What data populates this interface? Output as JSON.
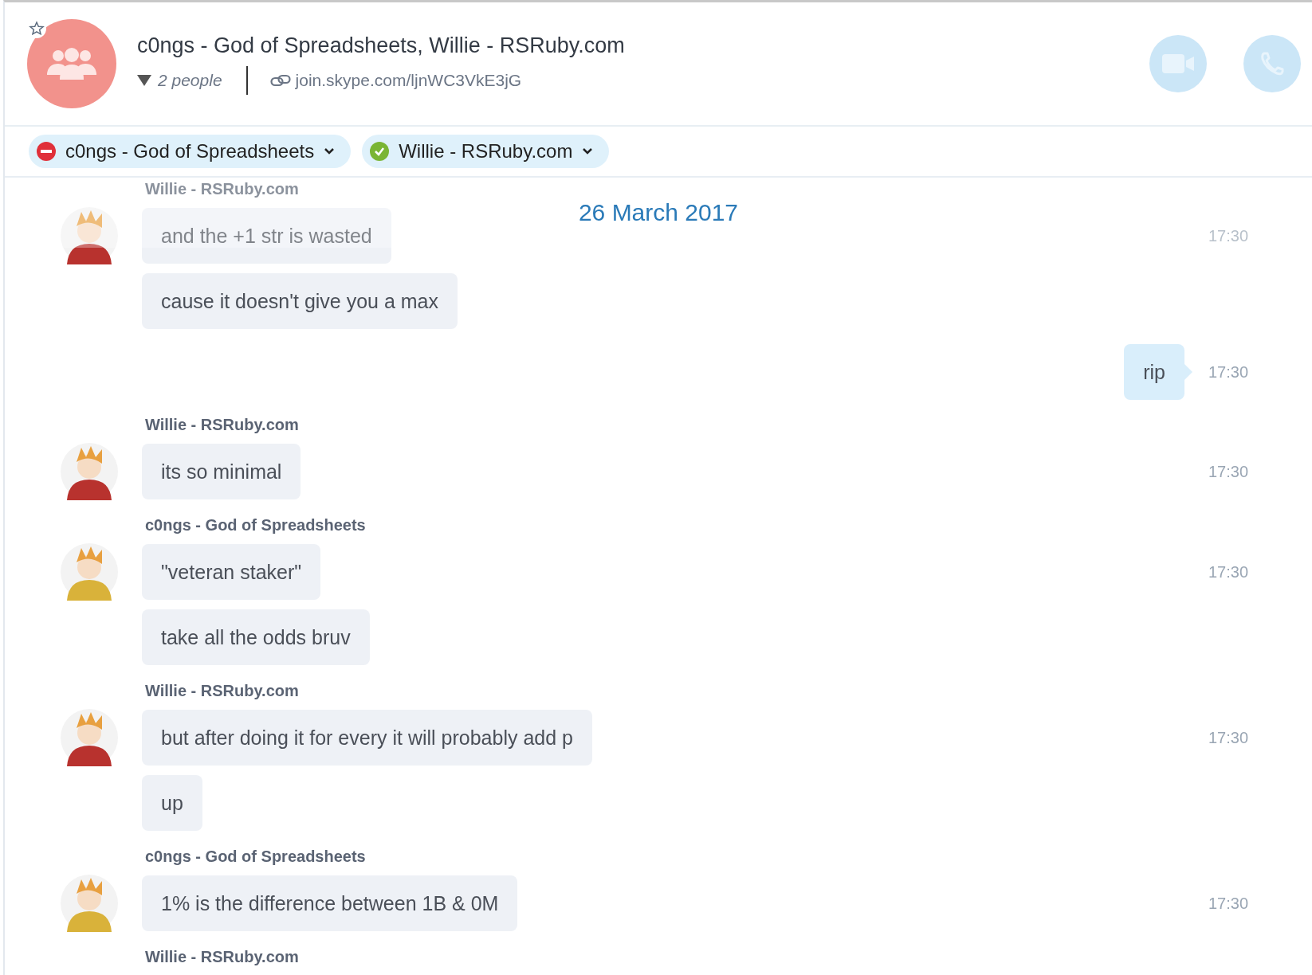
{
  "header": {
    "title": "c0ngs - God of Spreadsheets, Willie - RSRuby.com",
    "people": "2 people",
    "link": "join.skype.com/ljnWC3VkE3jG"
  },
  "participants": [
    {
      "name": "c0ngs - God of Spreadsheets",
      "online": false
    },
    {
      "name": "Willie - RSRuby.com",
      "online": true
    }
  ],
  "date_banner": "26 March 2017",
  "groups": [
    {
      "kind": "incoming",
      "sender": "Willie - RSRuby.com",
      "color": "#b8322e",
      "messages": [
        {
          "text": "and the +1 str is wasted",
          "time": "17:30"
        },
        {
          "text": "cause it doesn't give you a max"
        }
      ]
    },
    {
      "kind": "outgoing",
      "messages": [
        {
          "text": "rip",
          "time": "17:30"
        }
      ]
    },
    {
      "kind": "incoming",
      "sender": "Willie - RSRuby.com",
      "color": "#b8322e",
      "messages": [
        {
          "text": "its so minimal",
          "time": "17:30"
        }
      ]
    },
    {
      "kind": "incoming",
      "sender": "c0ngs - God of Spreadsheets",
      "color": "#d9b23a",
      "messages": [
        {
          "text": "\"veteran staker\"",
          "time": "17:30"
        },
        {
          "text": "take all the odds bruv"
        }
      ]
    },
    {
      "kind": "incoming",
      "sender": "Willie - RSRuby.com",
      "color": "#b8322e",
      "messages": [
        {
          "text": "but after doing it for every it will probably add p",
          "time": "17:30"
        },
        {
          "text": "up"
        }
      ]
    },
    {
      "kind": "incoming",
      "sender": "c0ngs - God of Spreadsheets",
      "color": "#d9b23a",
      "messages": [
        {
          "text": "1% is the difference between 1B & 0M",
          "time": "17:30"
        }
      ]
    },
    {
      "kind": "incoming",
      "sender": "Willie - RSRuby.com"
    }
  ]
}
